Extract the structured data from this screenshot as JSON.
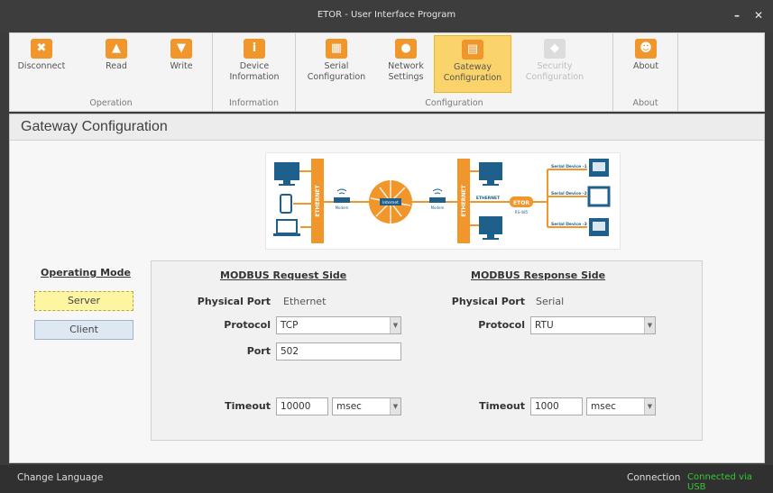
{
  "window": {
    "title": "ETOR - User Interface Program"
  },
  "ribbon": {
    "groups": [
      {
        "label": "Operation",
        "buttons": [
          {
            "label": "Disconnect",
            "icon": "x-icon"
          },
          {
            "label": "Read",
            "icon": "cloud-upload-icon"
          },
          {
            "label": "Write",
            "icon": "cloud-download-icon"
          }
        ]
      },
      {
        "label": "Information",
        "buttons": [
          {
            "label": "Device\nInformation",
            "icon": "info-icon"
          }
        ]
      },
      {
        "label": "Configuration",
        "buttons": [
          {
            "label": "Serial\nConfiguration",
            "icon": "network-tree-icon"
          },
          {
            "label": "Network\nSettings",
            "icon": "globe-icon"
          },
          {
            "label": "Gateway\nConfiguration",
            "icon": "gateway-icon"
          },
          {
            "label": "Security\nConfiguration",
            "icon": "shield-icon"
          }
        ]
      },
      {
        "label": "About",
        "buttons": [
          {
            "label": "About",
            "icon": "users-icon"
          }
        ]
      }
    ],
    "active_button": "Gateway\nConfiguration"
  },
  "page": {
    "title": "Gateway Configuration"
  },
  "diagram": {
    "eth_bar_left": "ETHERNET",
    "eth_bar_right": "ETHERNET",
    "modem_left": "Modem",
    "modem_right": "Modem",
    "internet": "Internet",
    "ethernet_label": "ETHERNET",
    "etor_label": "ETOR",
    "rs485": "RS-485",
    "serial_devices": [
      "Serial Device -1",
      "Serial Device -2",
      "Serial Device -3"
    ]
  },
  "operating_mode": {
    "title": "Operating Mode",
    "server": "Server",
    "client": "Client",
    "selected": "Server"
  },
  "request_side": {
    "title": "MODBUS Request Side",
    "physical_port_label": "Physical Port",
    "physical_port_value": "Ethernet",
    "protocol_label": "Protocol",
    "protocol_value": "TCP",
    "port_label": "Port",
    "port_value": "502",
    "timeout_label": "Timeout",
    "timeout_value": "10000",
    "timeout_unit": "msec"
  },
  "response_side": {
    "title": "MODBUS Response Side",
    "physical_port_label": "Physical Port",
    "physical_port_value": "Serial",
    "protocol_label": "Protocol",
    "protocol_value": "RTU",
    "timeout_label": "Timeout",
    "timeout_value": "1000",
    "timeout_unit": "msec"
  },
  "statusbar": {
    "change_language": "Change Language",
    "connection_label": "Connection",
    "connection_value": "Connected via USB"
  },
  "colors": {
    "accent": "#f0962a",
    "active": "#fbd36b",
    "connected": "#32c832",
    "diagram_blue": "#1f5f8b"
  }
}
